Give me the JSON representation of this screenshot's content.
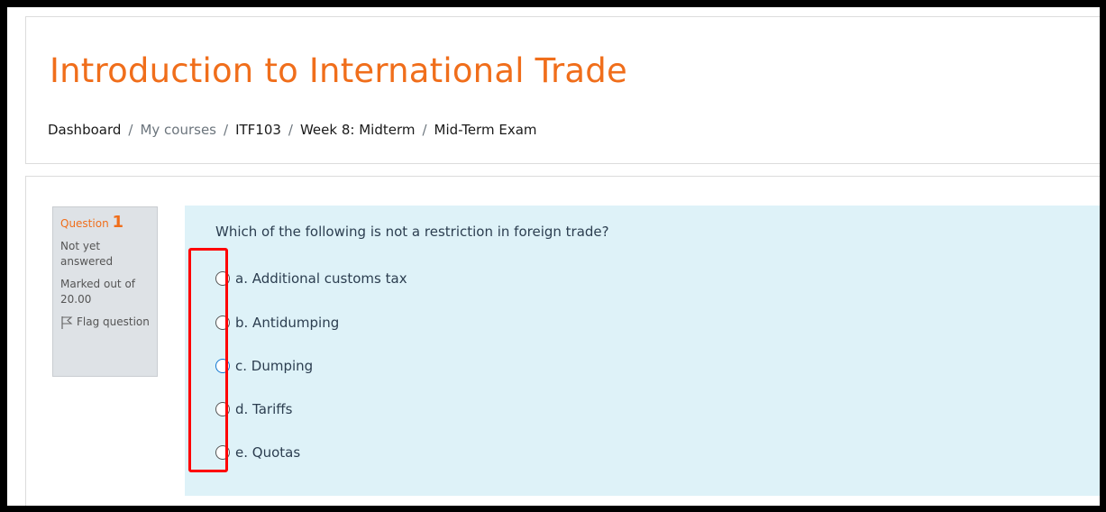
{
  "course": {
    "title": "Introduction to International Trade"
  },
  "breadcrumb": {
    "items": [
      "Dashboard",
      "My courses",
      "ITF103",
      "Week 8: Midterm",
      "Mid-Term Exam"
    ],
    "separator": "/"
  },
  "question": {
    "label": "Question",
    "number": "1",
    "state": "Not yet answered",
    "marked_out_of_label": "Marked out of",
    "marks": "20.00",
    "flag_label": "Flag question",
    "text": "Which of the following is not a restriction in foreign trade?",
    "answers": [
      "a. Additional customs tax",
      "b. Antidumping",
      "c. Dumping",
      "d. Tariffs",
      "e. Quotas"
    ]
  },
  "colors": {
    "accent": "#f06e1b",
    "formulation_bg": "#def2f8",
    "highlight": "#ff0000",
    "focus_radio": "#1177d1"
  }
}
